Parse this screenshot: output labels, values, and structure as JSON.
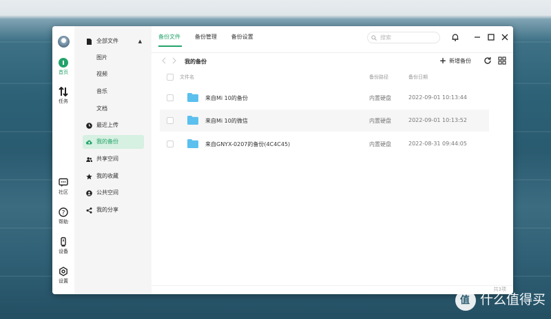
{
  "rail": {
    "items": [
      {
        "label": "首页",
        "icon": "home-icon"
      },
      {
        "label": "任务",
        "icon": "transfer-icon"
      },
      {
        "label": "社区",
        "icon": "community-icon"
      },
      {
        "label": "帮助",
        "icon": "help-icon"
      },
      {
        "label": "设备",
        "icon": "device-icon"
      },
      {
        "label": "设置",
        "icon": "settings-icon"
      }
    ]
  },
  "sidebar": {
    "all_files": "全部文件",
    "sub_items": [
      "图片",
      "视频",
      "音乐",
      "文档"
    ],
    "items": [
      {
        "label": "最近上传",
        "icon": "clock-icon"
      },
      {
        "label": "我的备份",
        "icon": "cloud-upload-icon"
      },
      {
        "label": "共享空间",
        "icon": "people-icon"
      },
      {
        "label": "我的收藏",
        "icon": "star-icon"
      },
      {
        "label": "公共空间",
        "icon": "public-icon"
      },
      {
        "label": "我的分享",
        "icon": "share-icon"
      }
    ]
  },
  "tabs": [
    "备份文件",
    "备份管理",
    "备份设置"
  ],
  "search": {
    "placeholder": "搜索"
  },
  "breadcrumb": {
    "title": "我的备份"
  },
  "toolbar": {
    "new_backup": "新增备份"
  },
  "table": {
    "headers": {
      "name": "文件名",
      "location": "备份路径",
      "date": "备份日期"
    },
    "rows": [
      {
        "name": "来自Mi 10的备份",
        "location": "内置硬盘",
        "date": "2022-09-01 10:13:44"
      },
      {
        "name": "来自Mi 10的微信",
        "location": "内置硬盘",
        "date": "2022-09-01 10:13:52"
      },
      {
        "name": "来自GNYX-0207的备份(4C4C45)",
        "location": "内置硬盘",
        "date": "2022-08-31 09:44:05"
      }
    ]
  },
  "footer": {
    "count": "共3项"
  },
  "watermark": {
    "text": "什么值得买",
    "badge": "值"
  },
  "colors": {
    "accent": "#23a36a",
    "sidebar_bg": "#f5f5f5",
    "active_bg": "#d6f0e1",
    "folder": "#5bc0ee"
  }
}
